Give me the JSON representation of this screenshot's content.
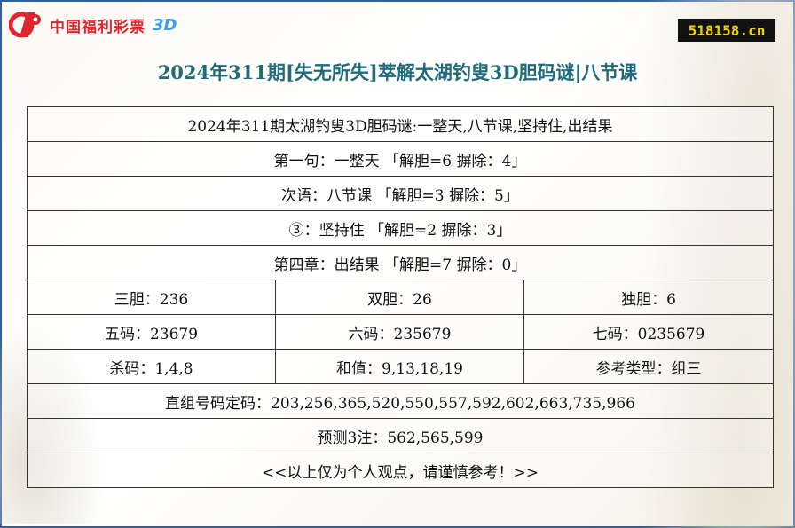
{
  "brand": {
    "name": "中国福利彩票",
    "suffix": "3D"
  },
  "site": "518158.cn",
  "title": "2024年311期[失无所失]萃解太湖钓叟3D胆码谜|八节课",
  "rows": {
    "heading": "2024年311期太湖钓叟3D胆码谜:一整天,八节课,坚持住,出结果",
    "line1": "第一句：一整天 「解胆=6 摒除：4」",
    "line2": "次语：八节课 「解胆=3 摒除：5」",
    "line3": "③：坚持住 「解胆=2 摒除：3」",
    "line4": "第四章：出结果 「解胆=7 摒除：0」",
    "sandan": "三胆：236",
    "shuangdan": "双胆：26",
    "dudan": "独胆：6",
    "wuma": "五码：23679",
    "liuma": "六码：235679",
    "qima": "七码：0235679",
    "shama": "杀码：1,4,8",
    "hezhi": "和值：9,13,18,19",
    "leixing": "参考类型：组三",
    "zhizu": "直组号码定码：203,256,365,520,550,557,592,602,663,735,966",
    "yuce": "预测3注：562,565,599",
    "note": "<<以上仅为个人观点，请谨慎参考！>>"
  }
}
